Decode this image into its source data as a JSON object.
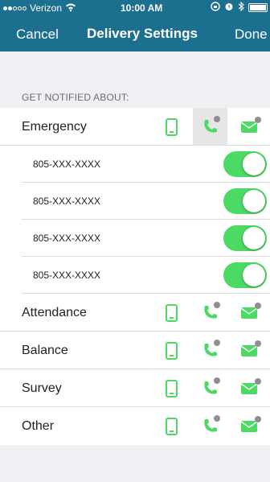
{
  "status_bar": {
    "carrier": "Verizon",
    "time": "10:00 AM"
  },
  "nav": {
    "left_label": "Cancel",
    "title": "Delivery Settings",
    "right_label": "Done"
  },
  "section_header": "GET NOTIFIED ABOUT:",
  "categories": [
    {
      "label": "Emergency",
      "phones": [
        "805-XXX-XXXX",
        "805-XXX-XXXX",
        "805-XXX-XXXX",
        "805-XXX-XXXX"
      ],
      "toggles_on": [
        true,
        true,
        true,
        true
      ]
    },
    {
      "label": "Attendance"
    },
    {
      "label": "Balance"
    },
    {
      "label": "Survey"
    },
    {
      "label": "Other"
    }
  ],
  "colors": {
    "nav": "#1d6f8f",
    "accent": "#4cd964",
    "background": "#efeff4"
  },
  "icons": {
    "text": "mobile-phone-icon",
    "call": "phone-call-icon",
    "email": "email-icon",
    "lock": "lock-icon"
  }
}
